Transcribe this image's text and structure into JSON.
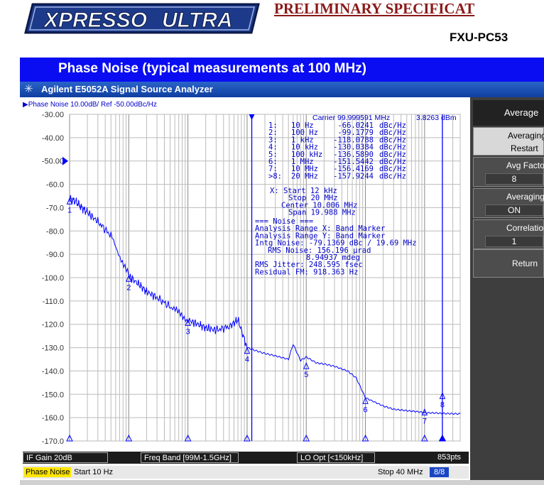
{
  "header": {
    "logo_text": "XPRESSO ULTRA",
    "prelim_title": "PRELIMINARY SPECIFICAT",
    "part_number": "FXU-PC53"
  },
  "banner": {
    "title": "Phase Noise (typical measurements at 100 MHz)"
  },
  "window": {
    "title": "Agilent E5052A Signal Source Analyzer"
  },
  "chart_data": {
    "type": "line",
    "trace_label": "Phase Noise 10.00dB/ Ref -50.00dBc/Hz",
    "x_scale": "log",
    "xlim": [
      10,
      40000000
    ],
    "ylim": [
      -170,
      -30
    ],
    "y_ticks": [
      "-30.00",
      "-40.00",
      "-50.00",
      "-60.0",
      "-70.0",
      "-80.0",
      "-90.0",
      "-100.0",
      "-110.0",
      "-120.0",
      "-130.0",
      "-140.0",
      "-150.0",
      "-160.0",
      "-170.0"
    ],
    "ref_marker_value": -50,
    "grid": true,
    "series": [
      {
        "x": [
          10,
          13,
          16,
          20,
          30,
          50,
          100,
          150,
          200,
          300,
          500,
          1000,
          1500,
          2000,
          3000,
          5000,
          7000,
          10000,
          13000,
          15000,
          17000,
          20000,
          30000,
          50000,
          60000,
          80000,
          100000,
          150000,
          200000,
          300000,
          500000,
          700000,
          1000000,
          2000000,
          3000000,
          5000000,
          8000000,
          10000000,
          15000000,
          20000000,
          30000000,
          40000000
        ],
        "y": [
          -66.0,
          -67.5,
          -70.0,
          -72.0,
          -76.0,
          -82.0,
          -99.2,
          -103.0,
          -106.0,
          -108.5,
          -112.5,
          -118.1,
          -120.0,
          -121.5,
          -122.5,
          -121.0,
          -118.0,
          -130.0,
          -131.0,
          -131.5,
          -132.0,
          -132.5,
          -133.5,
          -135.0,
          -128.5,
          -135.5,
          -134.0,
          -136.6,
          -137.0,
          -138.0,
          -140.0,
          -143.0,
          -151.5,
          -155.0,
          -156.4,
          -157.0,
          -157.5,
          -157.9,
          -158.0,
          -158.2,
          -158.3,
          -158.4
        ]
      }
    ],
    "markers": [
      {
        "label": "1",
        "x": 10,
        "y": -66.0241
      },
      {
        "label": "2",
        "x": 100,
        "y": -99.1779
      },
      {
        "label": "3",
        "x": 1000,
        "y": -118.0788
      },
      {
        "label": "4",
        "x": 10000,
        "y": -130.0384
      },
      {
        "label": "5",
        "x": 100000,
        "y": -136.589
      },
      {
        "label": "6",
        "x": 1000000,
        "y": -151.5442
      },
      {
        "label": "7",
        "x": 10000000,
        "y": -156.4169
      },
      {
        "label": "8",
        "x": 20000000,
        "y": -157.9244
      }
    ],
    "band_marker_start": 12000,
    "band_marker_stop": 20000000,
    "carrier_text": "Carrier 99.999591 MHz",
    "carrier_level": "3.8263 dBm",
    "marker_table": [
      {
        "id": "1:",
        "freq": "10 Hz",
        "val": "-66.0241",
        "unit": "dBc/Hz"
      },
      {
        "id": "2:",
        "freq": "100 Hz",
        "val": "-99.1779",
        "unit": "dBc/Hz"
      },
      {
        "id": "3:",
        "freq": "1 kHz",
        "val": "-118.0788",
        "unit": "dBc/Hz"
      },
      {
        "id": "4:",
        "freq": "10 kHz",
        "val": "-130.0384",
        "unit": "dBc/Hz"
      },
      {
        "id": "5:",
        "freq": "100 kHz",
        "val": "-136.5890",
        "unit": "dBc/Hz"
      },
      {
        "id": "6:",
        "freq": "1 MHz",
        "val": "-151.5442",
        "unit": "dBc/Hz"
      },
      {
        "id": "7:",
        "freq": "10 MHz",
        "val": "-156.4169",
        "unit": "dBc/Hz"
      },
      {
        "id": ">8:",
        "freq": "20 MHz",
        "val": "-157.9244",
        "unit": "dBc/Hz"
      }
    ],
    "range_lines": [
      "X: Start 12 kHz",
      "Stop 20 MHz",
      "Center 10.006 MHz",
      "Span 19.988 MHz"
    ],
    "noise_lines": [
      "=== Noise ===",
      "Analysis Range X: Band Marker",
      "Analysis Range Y: Band Marker",
      "Intg Noise: -79.1369 dBc / 19.69 MHz",
      "RMS Noise: 156.196 µrad",
      "8.94937 mdeg",
      "RMS Jitter: 248.595 fsec",
      "Residual FM: 918.363 Hz"
    ]
  },
  "status_bar": {
    "if_gain": "IF Gain 20dB",
    "freq_band": "Freq Band [99M-1.5GHz]",
    "lo_opt": "LO Opt [<150kHz]",
    "points": "853pts"
  },
  "channel_bar": {
    "trace": "Phase Noise",
    "start": "Start 10 Hz",
    "stop": "Stop 40 MHz",
    "count": "8/8"
  },
  "softkeys": {
    "header": "Average",
    "averaging_restart_l1": "Averaging",
    "averaging_restart_l2": "Restart",
    "avg_factor_l1": "Avg Facto",
    "avg_factor_l2": "8",
    "averaging_l1": "Averaging",
    "averaging_l2": "ON",
    "correlation_l1": "Correlation",
    "correlation_l2": "1",
    "return": "Return"
  },
  "colors": {
    "banner": "#0a0df2",
    "trace": "#0000ff",
    "title_red": "#8a1a1a"
  }
}
